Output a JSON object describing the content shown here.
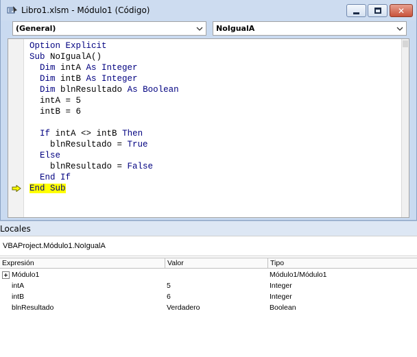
{
  "window": {
    "title": "Libro1.xlsm - Módulo1 (Código)",
    "close_label": "✕"
  },
  "combos": {
    "object": "(General)",
    "procedure": "NoIgualA"
  },
  "code": {
    "l1_kw": "Option Explicit",
    "l2_kw": "Sub",
    "l2_rest": " NoIgualA()",
    "l3_kw1": "Dim",
    "l3_mid": " intA ",
    "l3_kw2": "As Integer",
    "l4_kw1": "Dim",
    "l4_mid": " intB ",
    "l4_kw2": "As Integer",
    "l5_kw1": "Dim",
    "l5_mid": " blnResultado ",
    "l5_kw2": "As Boolean",
    "l6": "intA = 5",
    "l7": "intB = 6",
    "l9_kw1": "If",
    "l9_mid": " intA <> intB ",
    "l9_kw2": "Then",
    "l10_pre": "blnResultado = ",
    "l10_kw": "True",
    "l11_kw": "Else",
    "l12_pre": "blnResultado = ",
    "l12_kw": "False",
    "l13_kw": "End If",
    "l14_kw": "End Sub"
  },
  "locals": {
    "title": "Locales",
    "context": "VBAProject.Módulo1.NoIgualA",
    "headers": [
      "Expresión",
      "Valor",
      "Tipo"
    ],
    "rows": [
      {
        "expr": "Módulo1",
        "value": "",
        "type": "Módulo1/Módulo1"
      },
      {
        "expr": "intA",
        "value": "5",
        "type": "Integer"
      },
      {
        "expr": "intB",
        "value": "6",
        "type": "Integer"
      },
      {
        "expr": "blnResultado",
        "value": "Verdadero",
        "type": "Boolean"
      }
    ]
  },
  "colors": {
    "keyword": "#000080",
    "highlight": "#ffff00",
    "exec_arrow": "#ffff00"
  }
}
